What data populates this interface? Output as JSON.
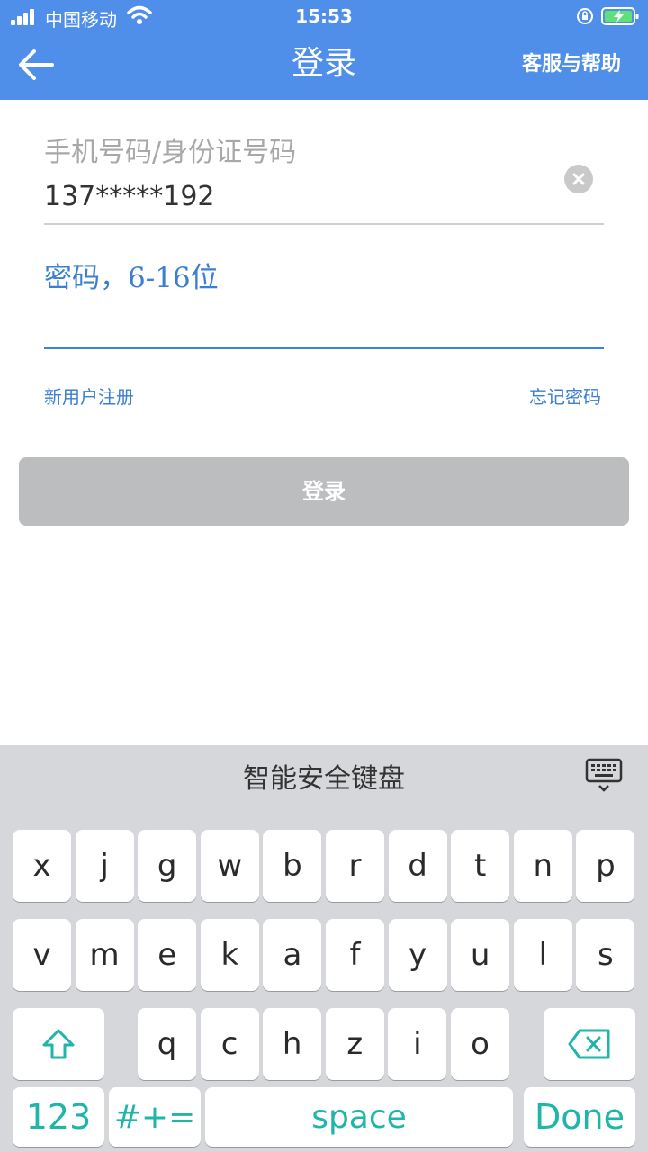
{
  "status_bar": {
    "carrier": "中国移动",
    "time": "15:53"
  },
  "header": {
    "title": "登录",
    "help_label": "客服与帮助"
  },
  "form": {
    "account_placeholder": "手机号码/身份证号码",
    "account_value": "137*****192",
    "password_placeholder": "密码，6-16位",
    "register_label": "新用户注册",
    "forgot_label": "忘记密码",
    "login_button": "登录"
  },
  "keyboard": {
    "title": "智能安全键盘",
    "row1": [
      "x",
      "j",
      "g",
      "w",
      "b",
      "r",
      "d",
      "t",
      "n",
      "p"
    ],
    "row2": [
      "v",
      "m",
      "e",
      "k",
      "a",
      "f",
      "y",
      "u",
      "l",
      "s"
    ],
    "row3": [
      "q",
      "c",
      "h",
      "z",
      "i",
      "o"
    ],
    "numbers_key": "123",
    "symbols_key": "#+=",
    "space_key": "space",
    "done_key": "Done"
  },
  "colors": {
    "header_bg": "#4f8fe9",
    "link": "#3a7fd1",
    "keyboard_accent": "#1fb6a7"
  }
}
